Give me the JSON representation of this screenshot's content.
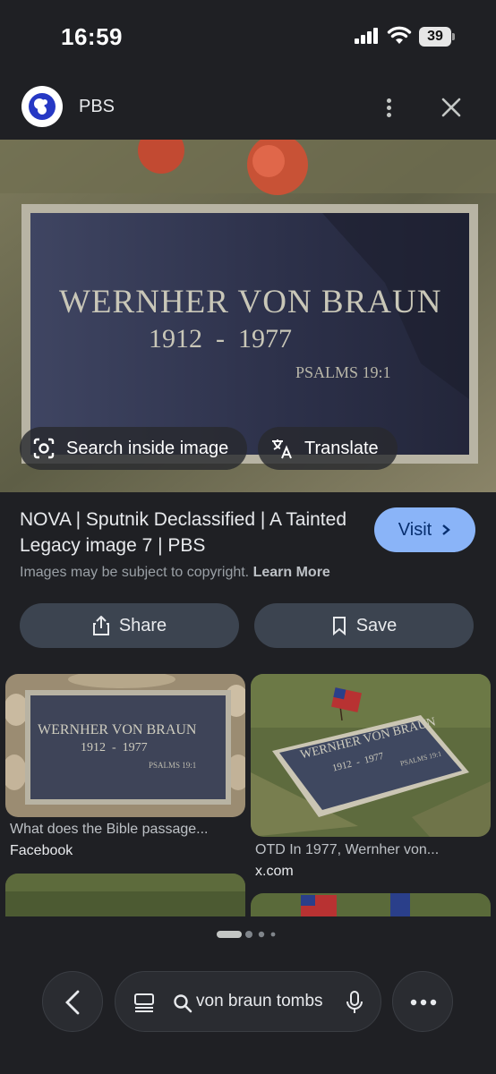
{
  "status_bar": {
    "time": "16:59",
    "battery": "39"
  },
  "source": {
    "name": "PBS"
  },
  "hero": {
    "inscription_name": "WERNHER VON BRAUN",
    "inscription_years": "1912  -  1977",
    "inscription_verse": "PSALMS 19:1",
    "search_inside_label": "Search inside image",
    "translate_label": "Translate"
  },
  "result": {
    "title": "NOVA | Sputnik Declassified | A Tainted Legacy image 7 | PBS",
    "visit_label": "Visit",
    "copyright_text": "Images may be subject to copyright.",
    "learn_more": "Learn More",
    "share_label": "Share",
    "save_label": "Save"
  },
  "related": [
    {
      "caption": "What does the Bible passage...",
      "source": "Facebook",
      "inscription_name": "WERNHER VON BRAUN",
      "inscription_years": "1912  -  1977",
      "inscription_verse": "PSALMS 19:1"
    },
    {
      "caption": "OTD In 1977, Wernher von...",
      "source": "x.com",
      "inscription_name": "WERNHER VON BRAUN",
      "inscription_years": "1912  -  1977",
      "inscription_verse": "PSALMS 19:1"
    }
  ],
  "search": {
    "query": "von braun tombs"
  },
  "colors": {
    "background": "#1f2024",
    "visit": "#8ab4f8",
    "chip": "#3c4450"
  }
}
